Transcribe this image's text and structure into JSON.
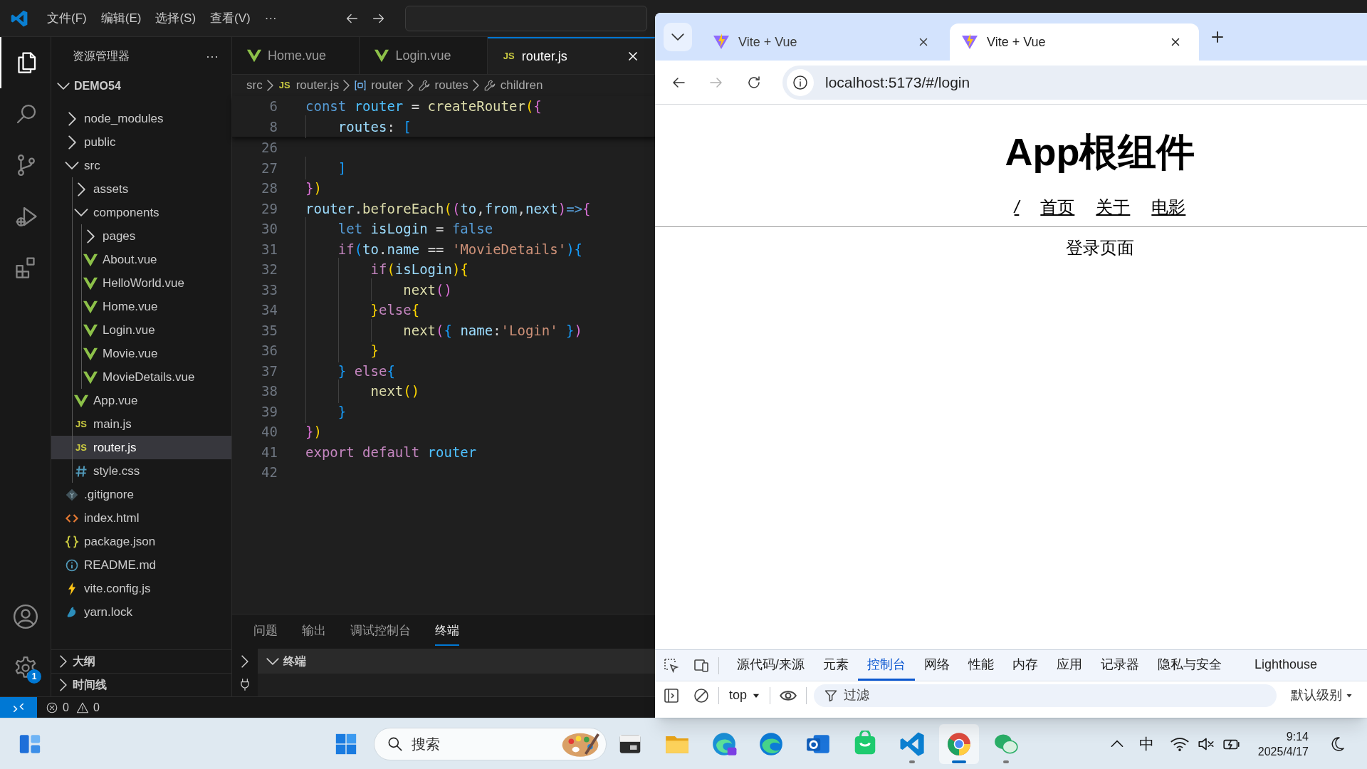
{
  "menu_bar": {
    "items": [
      "文件(F)",
      "编辑(E)",
      "选择(S)",
      "查看(V)",
      "···"
    ]
  },
  "activity_bar": {
    "items": [
      {
        "kind": "explorer",
        "selected": true
      },
      {
        "kind": "search",
        "selected": false
      },
      {
        "kind": "source-control",
        "selected": false
      },
      {
        "kind": "run",
        "selected": false
      },
      {
        "kind": "extensions",
        "selected": false
      }
    ],
    "settings_badge": "1"
  },
  "explorer": {
    "title": "资源管理器",
    "more": "···",
    "project": {
      "name": "DEMO54",
      "expanded": true
    },
    "tree": [
      {
        "label": "node_modules",
        "kind": "folder",
        "expanded": false,
        "selected": false
      },
      {
        "label": "public",
        "kind": "folder",
        "expanded": false,
        "selected": false
      },
      {
        "label": "src",
        "kind": "folder",
        "expanded": true,
        "selected": false,
        "children": [
          {
            "label": "assets",
            "kind": "folder",
            "expanded": false,
            "selected": false
          },
          {
            "label": "components",
            "kind": "folder",
            "expanded": true,
            "selected": false,
            "children": [
              {
                "label": "pages",
                "kind": "folder",
                "expanded": false,
                "selected": false
              },
              {
                "label": "About.vue",
                "kind": "vue",
                "selected": false
              },
              {
                "label": "HelloWorld.vue",
                "kind": "vue",
                "selected": false
              },
              {
                "label": "Home.vue",
                "kind": "vue",
                "selected": false
              },
              {
                "label": "Login.vue",
                "kind": "vue",
                "selected": false
              },
              {
                "label": "Movie.vue",
                "kind": "vue",
                "selected": false
              },
              {
                "label": "MovieDetails.vue",
                "kind": "vue",
                "selected": false
              }
            ]
          },
          {
            "label": "App.vue",
            "kind": "vue",
            "selected": false
          },
          {
            "label": "main.js",
            "kind": "js",
            "icon_text": "JS",
            "selected": false
          },
          {
            "label": "router.js",
            "kind": "js",
            "icon_text": "JS",
            "selected": true
          },
          {
            "label": "style.css",
            "kind": "css",
            "selected": false
          }
        ]
      },
      {
        "label": ".gitignore",
        "kind": "git",
        "selected": false
      },
      {
        "label": "index.html",
        "kind": "html",
        "selected": false
      },
      {
        "label": "package.json",
        "kind": "json",
        "selected": false
      },
      {
        "label": "README.md",
        "kind": "info",
        "selected": false
      },
      {
        "label": "vite.config.js",
        "kind": "vite",
        "selected": false
      },
      {
        "label": "yarn.lock",
        "kind": "yarn",
        "selected": false
      }
    ],
    "sections": [
      {
        "label": "大纲",
        "expanded": false
      },
      {
        "label": "时间线",
        "expanded": false
      }
    ]
  },
  "editor": {
    "tabs": [
      {
        "label": "Home.vue",
        "kind": "vue",
        "selected": false
      },
      {
        "label": "Login.vue",
        "kind": "vue",
        "selected": false
      },
      {
        "label": "router.js",
        "kind": "js",
        "icon_text": "JS",
        "selected": true
      }
    ],
    "breadcrumbs": [
      {
        "label": "src",
        "kind": "folder"
      },
      {
        "label": "router.js",
        "kind": "js",
        "icon_text": "JS"
      },
      {
        "label": "router",
        "kind": "variable"
      },
      {
        "label": "routes",
        "kind": "property"
      },
      {
        "label": "children",
        "kind": "property"
      }
    ],
    "sticky_lines": [
      {
        "number": "6",
        "tokens": [
          {
            "text": "const ",
            "kind": "kw"
          },
          {
            "text": "router",
            "kind": "const"
          },
          {
            "text": " = ",
            "kind": "p"
          },
          {
            "text": "createRouter",
            "kind": "fn"
          },
          {
            "text": "(",
            "kind": "b1"
          },
          {
            "text": "{",
            "kind": "b2"
          }
        ]
      },
      {
        "number": "8",
        "tokens": [
          {
            "text": "    routes",
            "kind": "var"
          },
          {
            "text": ": ",
            "kind": "p"
          },
          {
            "text": "[",
            "kind": "b3"
          }
        ]
      }
    ],
    "lines": [
      {
        "number": "26"
      },
      {
        "number": "27",
        "tokens": [
          {
            "text": "    ]",
            "kind": "b3"
          }
        ]
      },
      {
        "number": "28",
        "tokens": [
          {
            "text": "}",
            "kind": "b2"
          },
          {
            "text": ")",
            "kind": "b1"
          }
        ]
      },
      {
        "number": "29",
        "tokens": [
          {
            "text": "router",
            "kind": "var"
          },
          {
            "text": ".",
            "kind": "p"
          },
          {
            "text": "beforeEach",
            "kind": "fn"
          },
          {
            "text": "(",
            "kind": "b1"
          },
          {
            "text": "(",
            "kind": "b2"
          },
          {
            "text": "to",
            "kind": "var"
          },
          {
            "text": ",",
            "kind": "p"
          },
          {
            "text": "from",
            "kind": "var"
          },
          {
            "text": ",",
            "kind": "p"
          },
          {
            "text": "next",
            "kind": "var"
          },
          {
            "text": ")",
            "kind": "b2"
          },
          {
            "text": "=>",
            "kind": "kw"
          },
          {
            "text": "{",
            "kind": "b2"
          }
        ]
      },
      {
        "number": "30",
        "tokens": [
          {
            "text": "    let ",
            "kind": "kw"
          },
          {
            "text": "isLogin",
            "kind": "var"
          },
          {
            "text": " = ",
            "kind": "p"
          },
          {
            "text": "false",
            "kind": "kw"
          }
        ]
      },
      {
        "number": "31",
        "tokens": [
          {
            "text": "    if",
            "kind": "ctl"
          },
          {
            "text": "(",
            "kind": "b3"
          },
          {
            "text": "to",
            "kind": "var"
          },
          {
            "text": ".",
            "kind": "p"
          },
          {
            "text": "name",
            "kind": "var"
          },
          {
            "text": " == ",
            "kind": "p"
          },
          {
            "text": "'MovieDetails'",
            "kind": "str"
          },
          {
            "text": ")",
            "kind": "b3"
          },
          {
            "text": "{",
            "kind": "b3"
          }
        ]
      },
      {
        "number": "32",
        "tokens": [
          {
            "text": "        if",
            "kind": "ctl"
          },
          {
            "text": "(",
            "kind": "b1"
          },
          {
            "text": "isLogin",
            "kind": "var"
          },
          {
            "text": ")",
            "kind": "b1"
          },
          {
            "text": "{",
            "kind": "b1"
          }
        ]
      },
      {
        "number": "33",
        "tokens": [
          {
            "text": "            next",
            "kind": "fn"
          },
          {
            "text": "()",
            "kind": "b2"
          }
        ]
      },
      {
        "number": "34",
        "tokens": [
          {
            "text": "        }",
            "kind": "b1"
          },
          {
            "text": "else",
            "kind": "ctl"
          },
          {
            "text": "{",
            "kind": "b1"
          }
        ]
      },
      {
        "number": "35",
        "tokens": [
          {
            "text": "            next",
            "kind": "fn"
          },
          {
            "text": "(",
            "kind": "b2"
          },
          {
            "text": "{ ",
            "kind": "b3"
          },
          {
            "text": "name",
            "kind": "var"
          },
          {
            "text": ":",
            "kind": "p"
          },
          {
            "text": "'Login' ",
            "kind": "str"
          },
          {
            "text": "}",
            "kind": "b3"
          },
          {
            "text": ")",
            "kind": "b2"
          }
        ]
      },
      {
        "number": "36",
        "tokens": [
          {
            "text": "        }",
            "kind": "b1"
          }
        ]
      },
      {
        "number": "37",
        "tokens": [
          {
            "text": "    }",
            "kind": "b3"
          },
          {
            "text": " else",
            "kind": "ctl"
          },
          {
            "text": "{",
            "kind": "b3"
          }
        ]
      },
      {
        "number": "38",
        "tokens": [
          {
            "text": "        next",
            "kind": "fn"
          },
          {
            "text": "()",
            "kind": "b1"
          }
        ]
      },
      {
        "number": "39",
        "tokens": [
          {
            "text": "    }",
            "kind": "b3"
          }
        ]
      },
      {
        "number": "40",
        "tokens": [
          {
            "text": "}",
            "kind": "b2"
          },
          {
            "text": ")",
            "kind": "b1"
          }
        ]
      },
      {
        "number": "41",
        "tokens": [
          {
            "text": "export ",
            "kind": "ctl"
          },
          {
            "text": "default ",
            "kind": "ctl"
          },
          {
            "text": "router",
            "kind": "const"
          }
        ]
      },
      {
        "number": "42"
      }
    ]
  },
  "panel": {
    "tabs": [
      {
        "label": "问题",
        "selected": false
      },
      {
        "label": "输出",
        "selected": false
      },
      {
        "label": "调试控制台",
        "selected": false
      },
      {
        "label": "终端",
        "selected": true
      }
    ],
    "terminal_header": "终端"
  },
  "status_bar": {
    "errors": "0",
    "warnings": "0"
  },
  "browser": {
    "tabs": [
      {
        "title": "Vite + Vue",
        "selected": false
      },
      {
        "title": "Vite + Vue",
        "selected": true
      }
    ],
    "nav_buttons": [
      {
        "kind": "back",
        "disabled": false
      },
      {
        "kind": "forward",
        "disabled": true
      },
      {
        "kind": "reload",
        "disabled": false
      }
    ],
    "address": "localhost:5173/#/login",
    "page": {
      "heading": "App根组件",
      "nav": [
        "/",
        "首页",
        "关于",
        "电影"
      ],
      "content": "登录页面"
    },
    "devtools": {
      "tabs": [
        {
          "label": "源代码/来源",
          "selected": false
        },
        {
          "label": "元素",
          "selected": false
        },
        {
          "label": "控制台",
          "selected": true
        },
        {
          "label": "网络",
          "selected": false
        },
        {
          "label": "性能",
          "selected": false
        },
        {
          "label": "内存",
          "selected": false
        },
        {
          "label": "应用",
          "selected": false
        },
        {
          "label": "记录器",
          "selected": false
        },
        {
          "label": "隐私与安全",
          "selected": false
        },
        {
          "label": "Lighthouse",
          "selected": false
        }
      ],
      "context": "top",
      "filter": {
        "placeholder": "过滤"
      },
      "level": "默认级别"
    }
  },
  "taskbar": {
    "search": {
      "placeholder": "搜索"
    },
    "apps": [
      {
        "kind": "terminal",
        "running": false,
        "selected": false
      },
      {
        "kind": "folder",
        "running": false,
        "selected": false
      },
      {
        "kind": "edge-ai",
        "running": false,
        "selected": false
      },
      {
        "kind": "edge",
        "running": false,
        "selected": false
      },
      {
        "kind": "mail",
        "running": false,
        "selected": false
      },
      {
        "kind": "store",
        "running": false,
        "selected": false
      },
      {
        "kind": "vscode",
        "running": true,
        "selected": false
      },
      {
        "kind": "chrome",
        "running": true,
        "selected": true
      },
      {
        "kind": "chat",
        "running": true,
        "selected": false
      }
    ],
    "ime": "中",
    "clock": {
      "time": "9:14",
      "date": "2025/4/17"
    }
  }
}
